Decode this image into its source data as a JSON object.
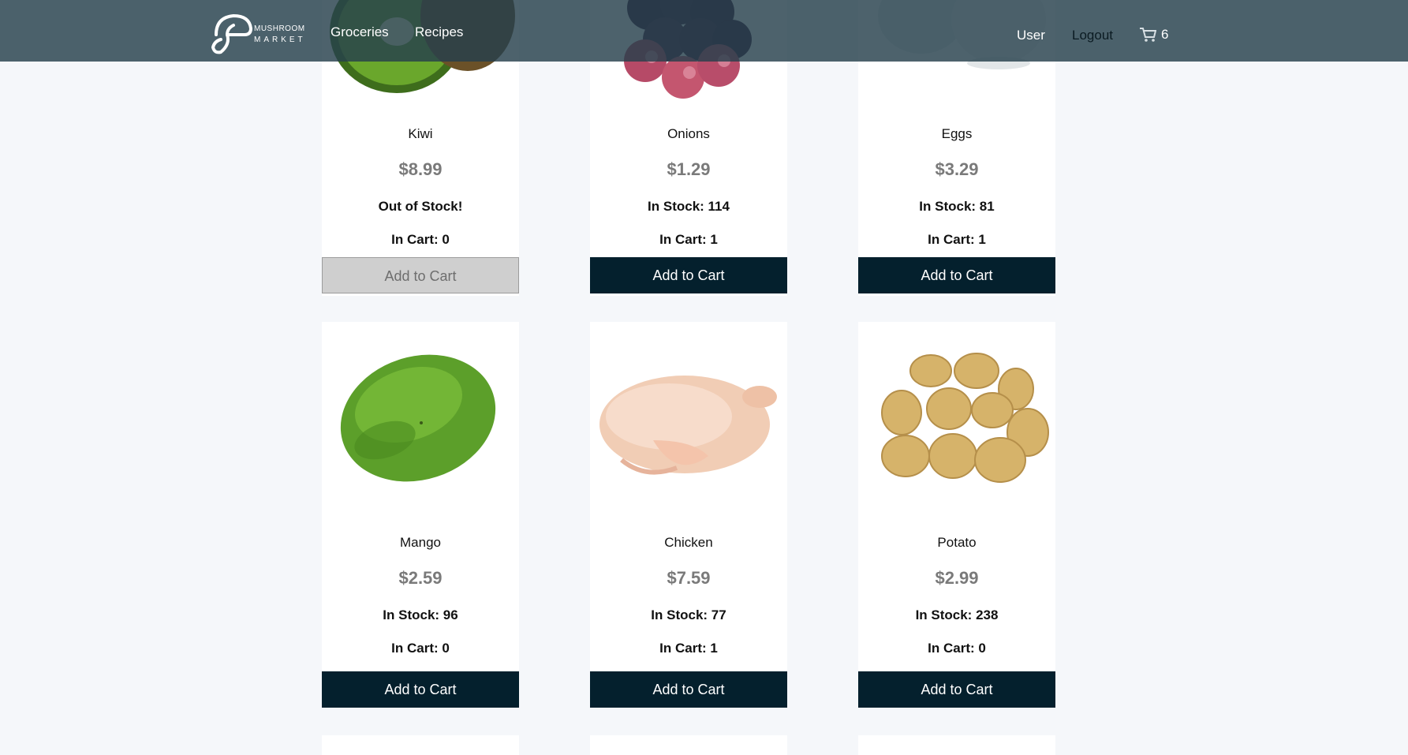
{
  "header": {
    "logo_line1": "MUSHROOM",
    "logo_line2": "MARKET",
    "nav": {
      "groceries": "Groceries",
      "recipes": "Recipes"
    },
    "user_label": "User",
    "logout_label": "Logout",
    "cart_count": "6",
    "icons": {
      "logo": "mushroom-logo-icon",
      "cart": "shopping-cart-icon"
    }
  },
  "products": [
    {
      "name": "Kiwi",
      "price": "$8.99",
      "stock": "Out of Stock!",
      "in_cart": "In Cart: 0",
      "button": "Add to Cart",
      "disabled": true
    },
    {
      "name": "Onions",
      "price": "$1.29",
      "stock": "In Stock: 114",
      "in_cart": "In Cart: 1",
      "button": "Add to Cart",
      "disabled": false
    },
    {
      "name": "Eggs",
      "price": "$3.29",
      "stock": "In Stock: 81",
      "in_cart": "In Cart: 1",
      "button": "Add to Cart",
      "disabled": false
    },
    {
      "name": "Mango",
      "price": "$2.59",
      "stock": "In Stock: 96",
      "in_cart": "In Cart: 0",
      "button": "Add to Cart",
      "disabled": false
    },
    {
      "name": "Chicken",
      "price": "$7.59",
      "stock": "In Stock: 77",
      "in_cart": "In Cart: 1",
      "button": "Add to Cart",
      "disabled": false
    },
    {
      "name": "Potato",
      "price": "$2.99",
      "stock": "In Stock: 238",
      "in_cart": "In Cart: 0",
      "button": "Add to Cart",
      "disabled": false
    }
  ],
  "colors": {
    "header_bg": "#263f4c",
    "button_bg": "#04202d",
    "button_disabled_bg": "#cfcfcf",
    "price": "#7a7a7a",
    "logout": "#0b1b22"
  }
}
